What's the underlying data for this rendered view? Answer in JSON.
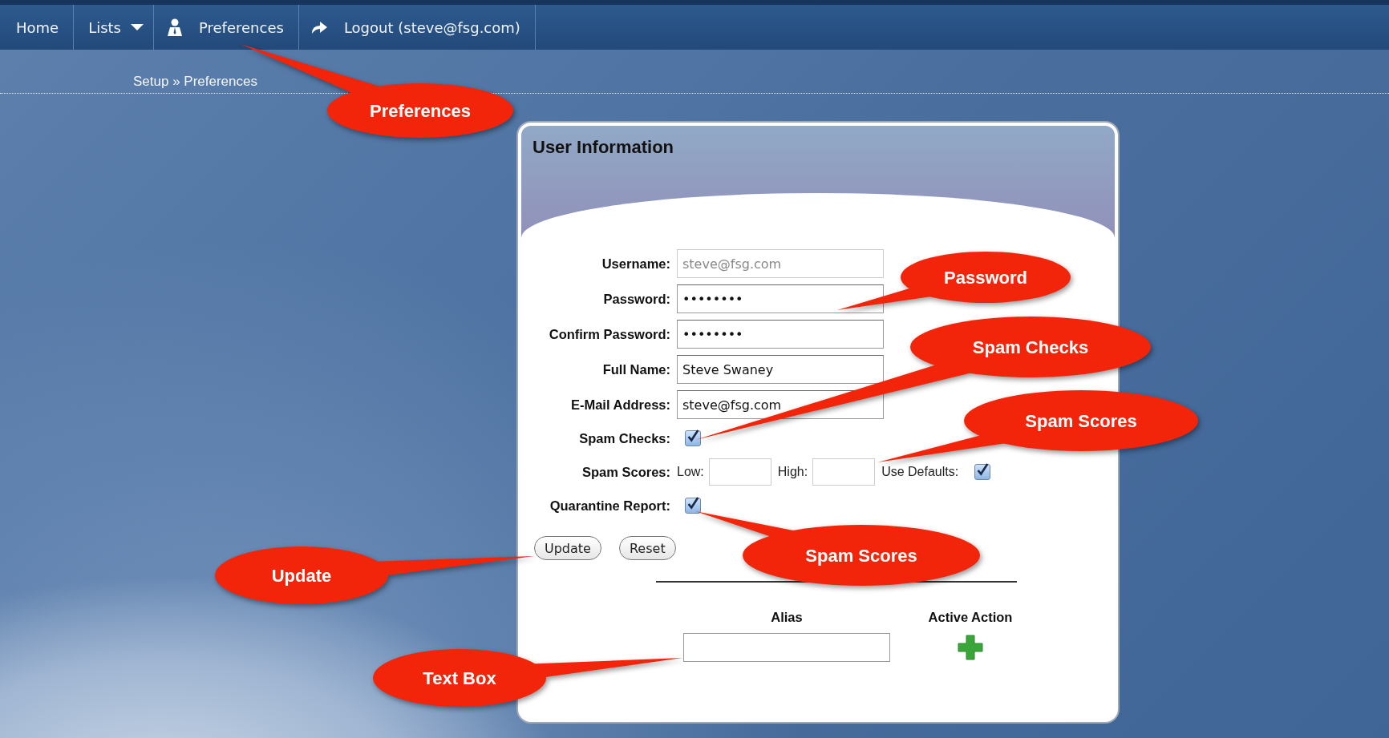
{
  "nav": {
    "items": [
      {
        "label": "Home",
        "kind": "link"
      },
      {
        "label": "Lists",
        "kind": "dropdown"
      },
      {
        "label": "Preferences",
        "kind": "user"
      },
      {
        "label": "Logout (steve@fsg.com)",
        "kind": "logout"
      }
    ]
  },
  "breadcrumb": "Setup » Preferences",
  "panel": {
    "title": "User Information",
    "fields": [
      {
        "kind": "text",
        "label": "Username:",
        "value": "steve@fsg.com",
        "disabled": true
      },
      {
        "kind": "text",
        "label": "Password:",
        "value": "••••••••",
        "disabled": false
      },
      {
        "kind": "text",
        "label": "Confirm Password:",
        "value": "••••••••",
        "disabled": false
      },
      {
        "kind": "text",
        "label": "Full Name:",
        "value": "Steve Swaney",
        "disabled": false
      },
      {
        "kind": "text",
        "label": "E-Mail Address:",
        "value": "steve@fsg.com",
        "disabled": false
      },
      {
        "kind": "checkbox",
        "label": "Spam Checks:",
        "checked": true
      },
      {
        "kind": "scores",
        "label": "Spam Scores:",
        "low_label": "Low:",
        "high_label": "High:",
        "defaults_label": "Use Defaults:",
        "use_defaults": true
      },
      {
        "kind": "checkbox",
        "label": "Quarantine Report:",
        "checked": true
      }
    ],
    "buttons": [
      "Update",
      "Reset"
    ],
    "alias_table": {
      "columns": [
        "Alias",
        "Active Action"
      ]
    }
  },
  "callouts": [
    "Preferences",
    "Password",
    "Spam Checks",
    "Spam Scores",
    "Spam Scores",
    "Update",
    "Text Box"
  ]
}
